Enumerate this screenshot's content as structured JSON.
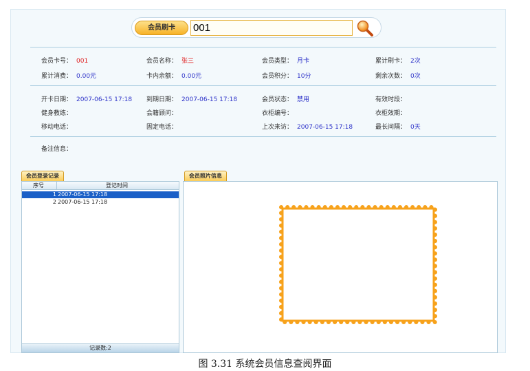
{
  "swipe": {
    "label": "会员刷卡",
    "value": "001"
  },
  "info_rows": {
    "card_no": {
      "label": "会员卡号：",
      "value": "001"
    },
    "name": {
      "label": "会员名称：",
      "value": "张三"
    },
    "type": {
      "label": "会员类型：",
      "value": "月卡"
    },
    "total_swipes": {
      "label": "累计刷卡：",
      "value": "2次"
    },
    "total_spend": {
      "label": "累计消费：",
      "value": "0.00元"
    },
    "balance": {
      "label": "卡内余额：",
      "value": "0.00元"
    },
    "points": {
      "label": "会员积分：",
      "value": "10分"
    },
    "remaining": {
      "label": "剩余次数：",
      "value": "0次"
    },
    "open_date": {
      "label": "开卡日期：",
      "value": "2007-06-15 17:18"
    },
    "expire_date": {
      "label": "到期日期：",
      "value": "2007-06-15 17:18"
    },
    "status": {
      "label": "会员状态：",
      "value": "禁用"
    },
    "valid_period": {
      "label": "有效时段：",
      "value": ""
    },
    "trainer": {
      "label": "健身教练：",
      "value": ""
    },
    "consultant": {
      "label": "会籍顾问：",
      "value": ""
    },
    "locker_no": {
      "label": "衣柜编号：",
      "value": ""
    },
    "locker_expire": {
      "label": "衣柜效期：",
      "value": ""
    },
    "mobile": {
      "label": "移动电话：",
      "value": ""
    },
    "phone": {
      "label": "固定电话：",
      "value": ""
    },
    "last_visit": {
      "label": "上次来访：",
      "value": "2007-06-15 17:18"
    },
    "longest_gap": {
      "label": "最长间隔：",
      "value": "0天"
    },
    "remarks": {
      "label": "备注信息：",
      "value": ""
    }
  },
  "login_records": {
    "tab": "会员登录记录",
    "col_no": "序号",
    "col_time": "登记时间",
    "rows": [
      {
        "no": "1",
        "time": "2007-06-15 17:18"
      },
      {
        "no": "2",
        "time": "2007-06-15 17:18"
      }
    ],
    "footer": "记录数:2"
  },
  "photo": {
    "tab": "会员照片信息"
  },
  "caption": "图 3.31 系统会员信息查阅界面",
  "colors": {
    "accent": "#f7a21b",
    "value": "#2e33c9",
    "highlight": "#e02020",
    "selection": "#1a5fc7"
  }
}
